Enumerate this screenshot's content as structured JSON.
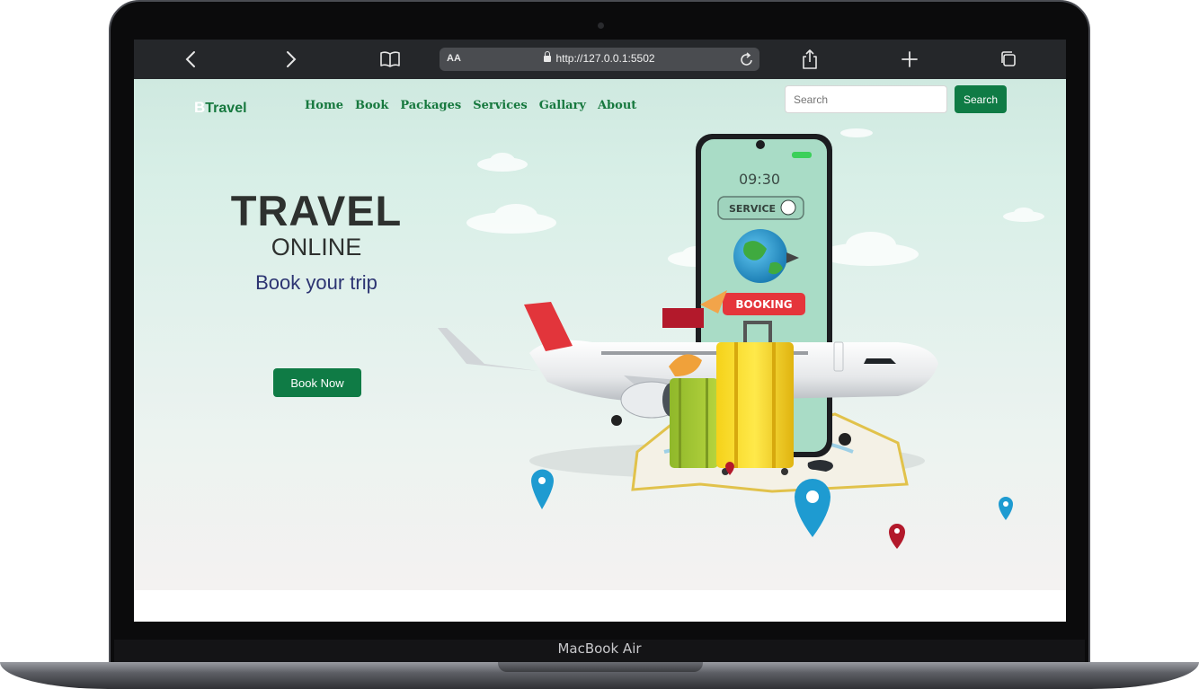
{
  "device": {
    "label": "MacBook Air"
  },
  "browser": {
    "text_size_label": "AA",
    "url": "http://127.0.0.1:5502",
    "icons": [
      "back-icon",
      "forward-icon",
      "bookmarks-icon",
      "lock-icon",
      "reload-icon",
      "share-icon",
      "new-tab-icon",
      "tabs-icon"
    ]
  },
  "site": {
    "brand_letter": "B",
    "brand_name": "Travel",
    "nav": [
      "Home",
      "Book",
      "Packages",
      "Services",
      "Gallary",
      "About"
    ],
    "search_placeholder": "Search",
    "search_button": "Search",
    "hero": {
      "title": "TRAVEL",
      "subtitle": "ONLINE",
      "tagline": "Book your trip",
      "button": "Book Now"
    },
    "illustration": {
      "phone_time": "09:30",
      "phone_service": "SERVICE",
      "phone_booking": "BOOKING"
    }
  },
  "colors": {
    "brand_green": "#0f7b45",
    "nav_green": "#16783e",
    "tagline_navy": "#2c3472"
  }
}
